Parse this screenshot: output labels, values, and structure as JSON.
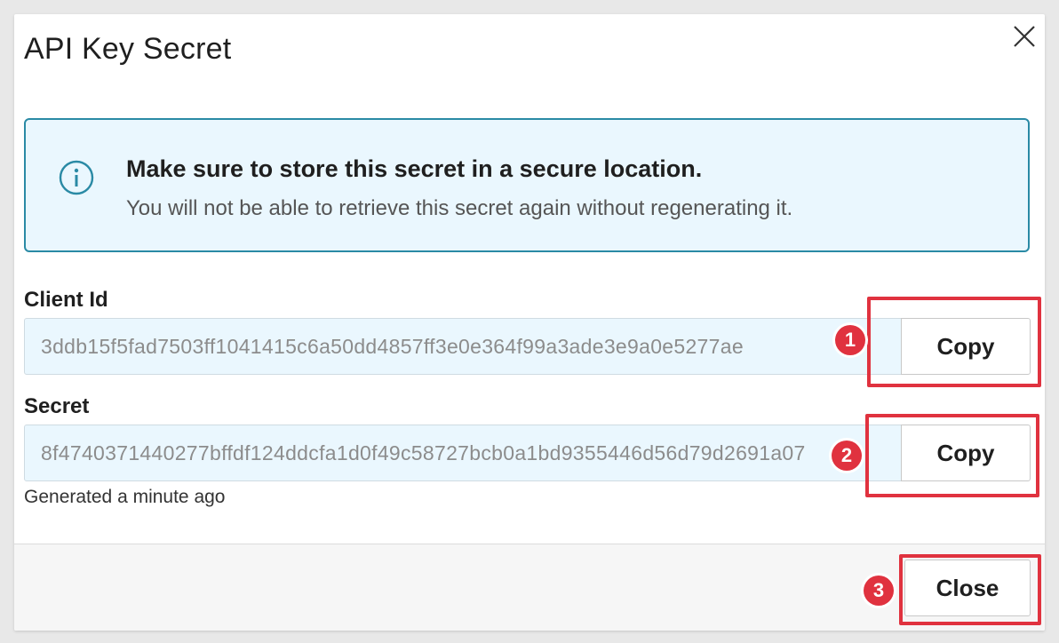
{
  "dialog": {
    "title": "API Key Secret"
  },
  "callout": {
    "heading": "Make sure to store this secret in a secure location.",
    "body": "You will not be able to retrieve this secret again without regenerating it."
  },
  "client_id": {
    "label": "Client Id",
    "value": "3ddb15f5fad7503ff1041415c6a50dd4857ff3e0e364f99a3ade3e9a0e5277ae",
    "copy_label": "Copy"
  },
  "secret": {
    "label": "Secret",
    "value": "8f4740371440277bffdf124ddcfa1d0f49c58727bcb0a1bd9355446d56d79d2691a07",
    "copy_label": "Copy",
    "generated_text": "Generated a minute ago"
  },
  "footer": {
    "close_label": "Close"
  },
  "annotations": {
    "step1": "1",
    "step2": "2",
    "step3": "3"
  },
  "colors": {
    "accent": "#2a8aa5",
    "callout_bg": "#eaf7fe",
    "annotation_red": "#e0323f"
  },
  "icons": {
    "close": "close-icon",
    "info": "info-icon"
  }
}
